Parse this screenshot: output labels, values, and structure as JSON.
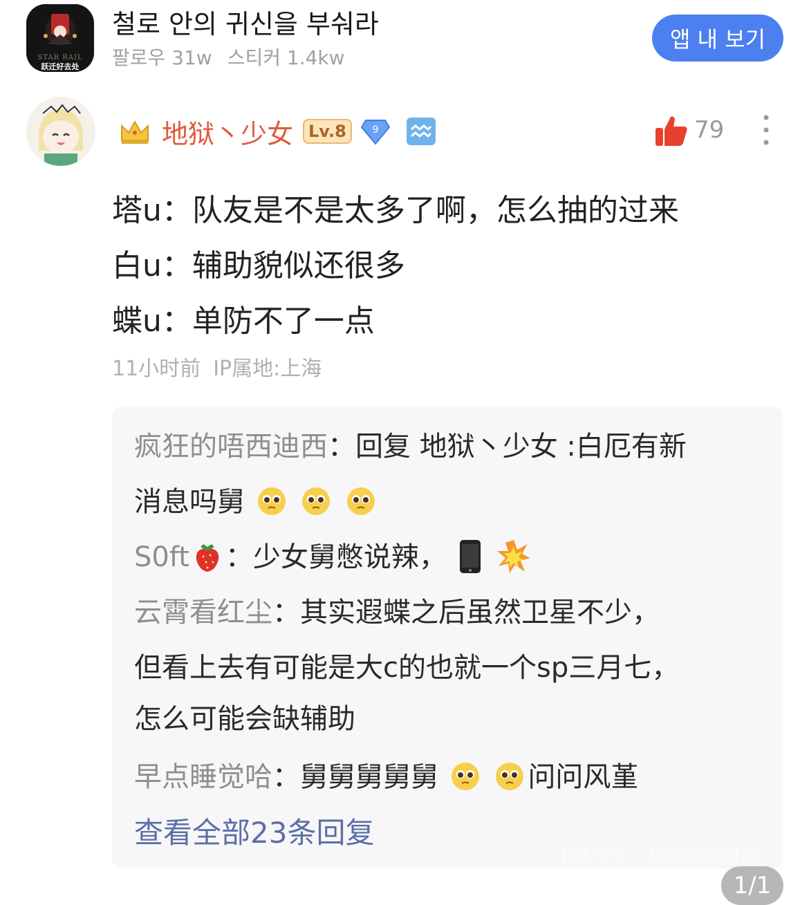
{
  "header": {
    "group_name": "철로 안의 귀신을 부숴라",
    "followers": "팔로우 31w",
    "stickers": "스티커 1.4kw",
    "open_app_label": "앱 내 보기",
    "avatar_text_top": "STAR RAIL",
    "avatar_text_bottom": "跃迁好去处"
  },
  "post": {
    "username": "地狱丶少女",
    "level": "Lv.8",
    "gem_number": "9",
    "likes": "79",
    "lines": [
      "塔u：队友是不是太多了啊，怎么抽的过来",
      "白u：辅助貌似还很多",
      "蝶u：单防不了一点"
    ],
    "time": "11小时前",
    "ip": "IP属地:上海",
    "accent_color": "#e05a3c"
  },
  "replies": {
    "items": [
      {
        "author": "疯狂的唔西迪西",
        "text_1": "：回复 地狱丶少女 :白厄有新",
        "text_2": "消息吗舅"
      },
      {
        "author": "S0ft",
        "text_1": "：少女舅憋说辣，"
      },
      {
        "author": "云霄看红尘",
        "text_1": "：其实遐蝶之后虽然卫星不少，",
        "text_2": "但看上去有可能是大c的也就一个sp三月七，",
        "text_3": "怎么可能会缺辅助"
      },
      {
        "author": "早点睡觉哈",
        "text_1": "：舅舅舅舅舅",
        "text_2": "问问风堇"
      }
    ],
    "view_all": "查看全部23条回复",
    "watermark": "小红书号：趣味动漫时刻"
  },
  "page_indicator": "1/1",
  "icons": [
    "crown-icon",
    "gem-icon",
    "zodiac-icon",
    "thumbs-up-icon",
    "more-icon",
    "pleading-emoji-icon",
    "strawberry-icon",
    "phone-icon",
    "explosion-icon"
  ]
}
